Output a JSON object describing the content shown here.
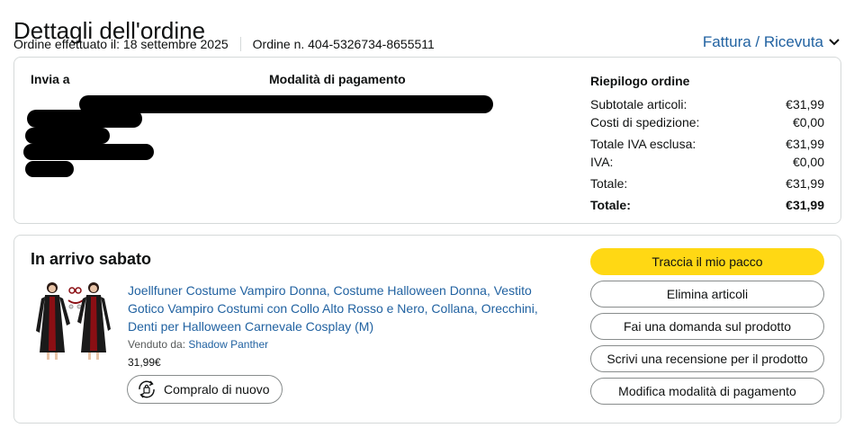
{
  "header": {
    "title": "Dettagli dell'ordine",
    "order_date": "Ordine effettuato il: 18 settembre 2025",
    "order_number": "Ordine n. 404-5326734-8655511",
    "invoice_link": "Fattura / Ricevuta"
  },
  "details": {
    "ship_to_label": "Invia a",
    "payment_label": "Modalità di pagamento",
    "summary_label": "Riepilogo ordine",
    "summary_rows": [
      {
        "label": "Subtotale articoli:",
        "value": "€31,99"
      },
      {
        "label": "Costi di spedizione:",
        "value": "€0,00"
      },
      {
        "label": "Totale IVA esclusa:",
        "value": "€31,99"
      },
      {
        "label": "IVA:",
        "value": "€0,00"
      },
      {
        "label": "Totale:",
        "value": "€31,99"
      },
      {
        "label": "Totale:",
        "value": "€31,99"
      }
    ]
  },
  "shipment": {
    "status": "In arrivo sabato",
    "product_title": "Joellfuner Costume Vampiro Donna, Costume Halloween Donna, Vestito Gotico Vampiro Costumi con Collo Alto Rosso e Nero, Collana, Orecchini, Denti per Halloween Carnevale Cosplay (M)",
    "seller_label": "Venduto da:",
    "seller_name": "Shadow Panther",
    "price": "31,99€",
    "buy_again_label": "Compralo di nuovo",
    "actions": [
      "Traccia il mio pacco",
      "Elimina articoli",
      "Fai una domanda sul prodotto",
      "Scrivi una recensione per il prodotto",
      "Modifica modalità di pagamento"
    ]
  },
  "colors": {
    "link": "#2162a1",
    "primary_button": "#ffd814",
    "border": "#d5d9d9"
  }
}
